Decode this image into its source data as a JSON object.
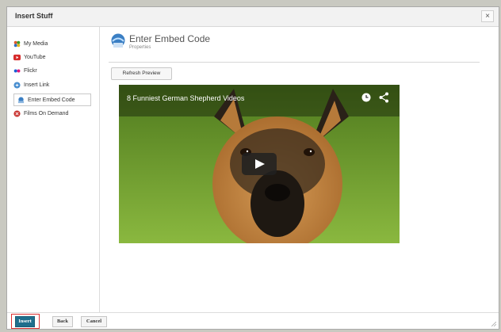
{
  "dialog": {
    "title": "Insert Stuff",
    "close_label": "×"
  },
  "sidebar": {
    "items": [
      {
        "label": "My Media",
        "icon": "my-media-icon"
      },
      {
        "label": "YouTube",
        "icon": "youtube-icon"
      },
      {
        "label": "Flickr",
        "icon": "flickr-icon"
      },
      {
        "label": "Insert Link",
        "icon": "insert-link-icon"
      },
      {
        "label": "Enter Embed Code",
        "icon": "embed-code-icon"
      },
      {
        "label": "Films On Demand",
        "icon": "films-on-demand-icon"
      }
    ]
  },
  "main": {
    "title": "Enter Embed Code",
    "subtitle": "Properties",
    "refresh_label": "Refresh Preview",
    "video": {
      "title": "8 Funniest German Shepherd Videos",
      "colors": {
        "grass": "#6d9b2c",
        "dog_tan": "#c88d4a",
        "dog_black": "#2a2118"
      }
    }
  },
  "footer": {
    "insert_label": "Insert",
    "back_label": "Back",
    "cancel_label": "Cancel"
  },
  "colors": {
    "accent": "#1f6e8c",
    "highlight": "#dd3333"
  }
}
